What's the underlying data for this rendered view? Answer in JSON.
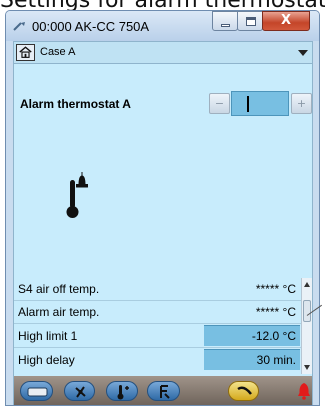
{
  "caption": "Settings for alarm thermostat",
  "window": {
    "title": "00:000 AK-CC 750A",
    "close_glyph": "X"
  },
  "casebar": {
    "selected": "Case A"
  },
  "section": {
    "title": "Alarm thermostat A",
    "minus_glyph": "−",
    "plus_glyph": "+"
  },
  "rows": [
    {
      "label": "S4 air off temp.",
      "value": "***** °C",
      "highlight": false
    },
    {
      "label": "Alarm air temp.",
      "value": "***** °C",
      "highlight": false
    },
    {
      "label": "High limit 1",
      "value": "-12.0 °C",
      "highlight": true
    },
    {
      "label": "High delay",
      "value": "30 min.",
      "highlight": true
    }
  ],
  "toolbar": {
    "items": [
      "display-icon",
      "fan-icon",
      "thermostat-icon",
      "defrost-icon",
      "wrench-icon"
    ],
    "alarm_icon": "bell-icon",
    "alarm_color": "#e21b1b"
  }
}
